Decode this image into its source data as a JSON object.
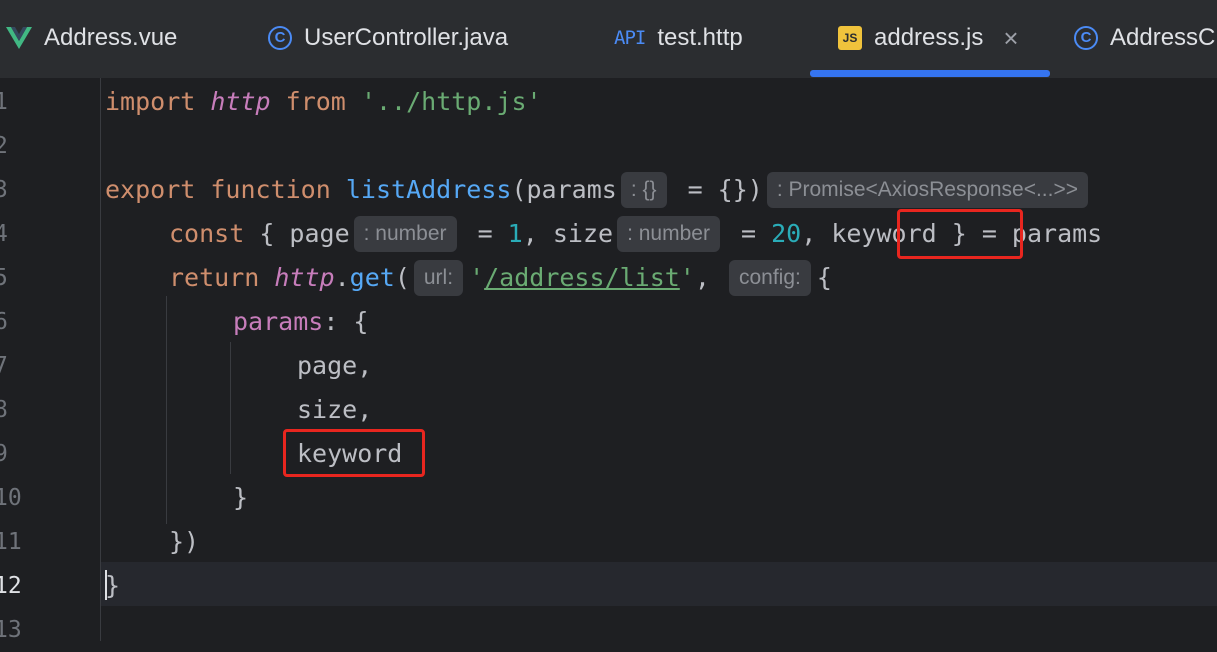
{
  "tabs": [
    {
      "label": "Address.vue",
      "icon": "vue-icon"
    },
    {
      "label": "UserController.java",
      "icon": "class-c-icon"
    },
    {
      "label": "test.http",
      "icon": "api-icon",
      "icon_text": "API"
    },
    {
      "label": "address.js",
      "icon": "js-icon",
      "icon_text": "JS",
      "active": true,
      "close": "×"
    },
    {
      "label": "AddressC",
      "icon": "class-c-icon"
    }
  ],
  "icon_glyphs": {
    "class_c": "C"
  },
  "line_numbers": [
    "1",
    "2",
    "3",
    "4",
    "5",
    "6",
    "7",
    "8",
    "9",
    "10",
    "11",
    "12",
    "13"
  ],
  "current_line": 12,
  "code": {
    "l1": {
      "import": "import",
      "http": "http",
      "from": "from",
      "path": "'../http.js'"
    },
    "l3": {
      "export": "export",
      "function": "function",
      "name": "listAddress",
      "open": "(",
      "param": "params",
      "hint_type": ": {}",
      "default": " = {})",
      "hint_return": ": Promise<AxiosResponse<...>>"
    },
    "l4": {
      "const": "const",
      "brace": " { ",
      "page": "page",
      "hint_page": ": number",
      "eq1": " = ",
      "one": "1",
      "comma1": ", ",
      "size": "size",
      "hint_size": ": number",
      "eq2": " = ",
      "twenty": "20",
      "comma2": ", ",
      "keyword": "keyword",
      "rest": " } = params"
    },
    "l5": {
      "return": "return",
      "http": "http",
      "dot": ".",
      "get": "get",
      "open": "(",
      "hint_url": "url:",
      "quote1": "'",
      "url": "/address/list",
      "quote2": "'",
      "comma": ", ",
      "hint_config": "config:",
      "brace": "{"
    },
    "l6": {
      "params": "params",
      "rest": ": {"
    },
    "l7": "page,",
    "l8": "size,",
    "l9": "keyword",
    "l10": "}",
    "l11": "})",
    "l12": "}"
  },
  "colors": {
    "keyword": "#cf8e6d",
    "string": "#6aab73",
    "function": "#56a8f5",
    "number": "#2aacb8",
    "property": "#c77dbb",
    "highlight_box": "#e8261f",
    "tab_underline": "#3574f0"
  }
}
